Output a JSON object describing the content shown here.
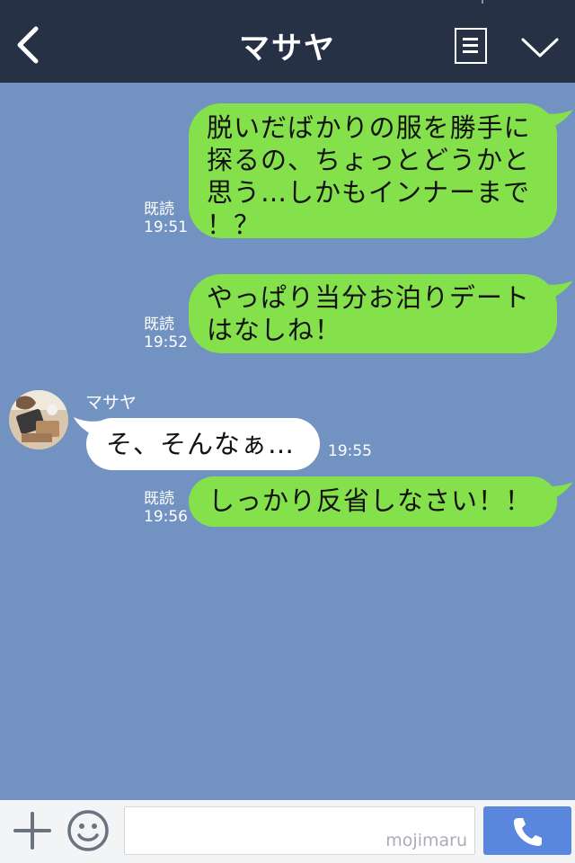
{
  "header": {
    "title": "マサヤ",
    "back_icon": "back-arrow-icon",
    "menu_icon": "menu-list-icon",
    "chevron_icon": "chevron-down-icon",
    "background_color": "#263146"
  },
  "chat": {
    "background_color": "#7292c2",
    "my_bubble_color": "#84e14b",
    "their_bubble_color": "#ffffff",
    "contact_name": "マサヤ",
    "messages": [
      {
        "from": "me",
        "lines": [
          "脱いだばかりの服を勝手に",
          "探るの、ちょっとどうかと",
          "思う…しかもインナーまで",
          "！？"
        ],
        "read": "既読",
        "time": "19:51"
      },
      {
        "from": "me",
        "lines": [
          "やっぱり当分お泊りデート",
          "はなしね！"
        ],
        "read": "既読",
        "time": "19:52"
      },
      {
        "from": "them",
        "lines": [
          "そ、そんなぁ…"
        ],
        "time": "19:55"
      },
      {
        "from": "me",
        "lines": [
          "しっかり反省しなさい！！"
        ],
        "read": "既読",
        "time": "19:56"
      }
    ]
  },
  "footer": {
    "plus_icon": "plus-icon",
    "emoji_icon": "smiley-icon",
    "input_value": "",
    "watermark": "mojimaru",
    "call_icon": "phone-icon",
    "call_button_color": "#5b86dd"
  }
}
